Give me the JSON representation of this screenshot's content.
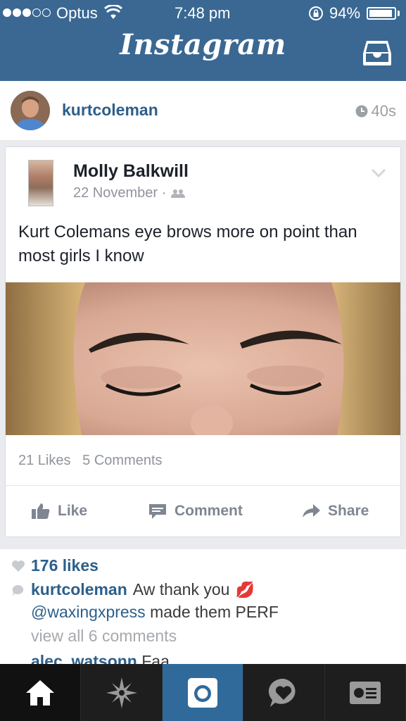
{
  "status_bar": {
    "carrier": "Optus",
    "time": "7:48 pm",
    "battery": "94%",
    "battery_level": 0.94,
    "signal_bars_filled": 3,
    "signal_bars_total": 5
  },
  "nav": {
    "title": "Instagram",
    "inbox_icon": "inbox-icon"
  },
  "post": {
    "username": "kurtcoleman",
    "age": "40s",
    "embedded": {
      "author": "Molly Balkwill",
      "date": "22 November",
      "separator": "·",
      "audience_icon": "friends-icon",
      "text": "Kurt Colemans eye brows more on point than most girls I know",
      "likes": "21 Likes",
      "comments": "5 Comments",
      "actions": {
        "like": "Like",
        "comment": "Comment",
        "share": "Share"
      }
    },
    "like_count": "176 likes",
    "caption": {
      "user": "kurtcoleman",
      "text_1": "Aw thank you",
      "emoji": "💋",
      "mention": "@waxingxpress",
      "text_2": "made them PERF"
    },
    "view_all": "view all 6 comments",
    "next_comment": {
      "user": "alec_watsonn",
      "text": "Faa"
    }
  },
  "tabs": [
    {
      "name": "home",
      "icon": "home-icon"
    },
    {
      "name": "explore",
      "icon": "explore-icon"
    },
    {
      "name": "camera",
      "icon": "camera-icon"
    },
    {
      "name": "activity",
      "icon": "activity-icon"
    },
    {
      "name": "profile",
      "icon": "profile-icon"
    }
  ],
  "colors": {
    "header": "#3a6892",
    "link": "#2c5f8a",
    "tab_bar": "#1e1e1e",
    "active_tab": "#2f6a9a"
  }
}
